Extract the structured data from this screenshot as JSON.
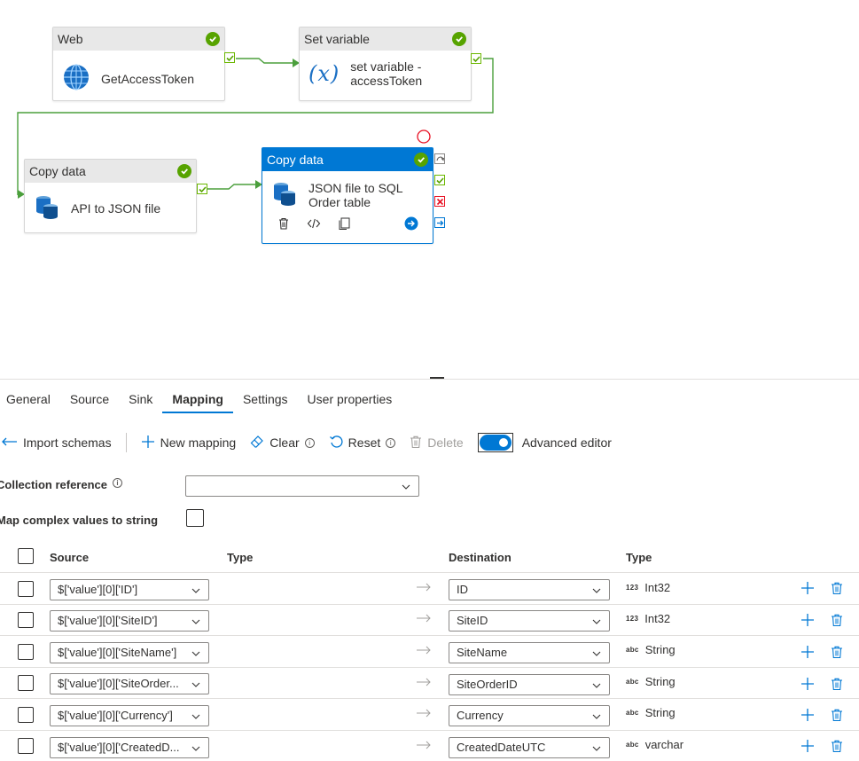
{
  "pipeline": {
    "activities": [
      {
        "type": "Web",
        "name": "GetAccessToken"
      },
      {
        "type": "Set variable",
        "name_line1": "set variable -",
        "name_line2": "accessToken"
      },
      {
        "type": "Copy data",
        "name": "API to JSON file"
      },
      {
        "type": "Copy data",
        "name_line1": "JSON file to SQL",
        "name_line2": "Order table"
      }
    ]
  },
  "tabs": [
    "General",
    "Source",
    "Sink",
    "Mapping",
    "Settings",
    "User properties"
  ],
  "active_tab": "Mapping",
  "toolbar": {
    "import_schemas": "Import schemas",
    "new_mapping": "New mapping",
    "clear": "Clear",
    "reset": "Reset",
    "delete": "Delete",
    "advanced_editor": "Advanced editor",
    "advanced_editor_on": true
  },
  "form": {
    "collection_reference_label": "Collection reference",
    "collection_reference_value": "",
    "map_complex_label": "Map complex values to string"
  },
  "table": {
    "headers": {
      "source": "Source",
      "source_type": "Type",
      "destination": "Destination",
      "dest_type": "Type"
    },
    "rows": [
      {
        "source": "$['value'][0]['ID']",
        "destination": "ID",
        "type_glyph": "123",
        "type": "Int32"
      },
      {
        "source": "$['value'][0]['SiteID']",
        "destination": "SiteID",
        "type_glyph": "123",
        "type": "Int32"
      },
      {
        "source": "$['value'][0]['SiteName']",
        "destination": "SiteName",
        "type_glyph": "abc",
        "type": "String"
      },
      {
        "source": "$['value'][0]['SiteOrder...",
        "destination": "SiteOrderID",
        "type_glyph": "abc",
        "type": "String"
      },
      {
        "source": "$['value'][0]['Currency']",
        "destination": "Currency",
        "type_glyph": "abc",
        "type": "String"
      },
      {
        "source": "$['value'][0]['CreatedD...",
        "destination": "CreatedDateUTC",
        "type_glyph": "abc",
        "type": "varchar"
      }
    ]
  },
  "colors": {
    "accent": "#0078d4",
    "success": "#57a300",
    "error": "#e81123"
  }
}
